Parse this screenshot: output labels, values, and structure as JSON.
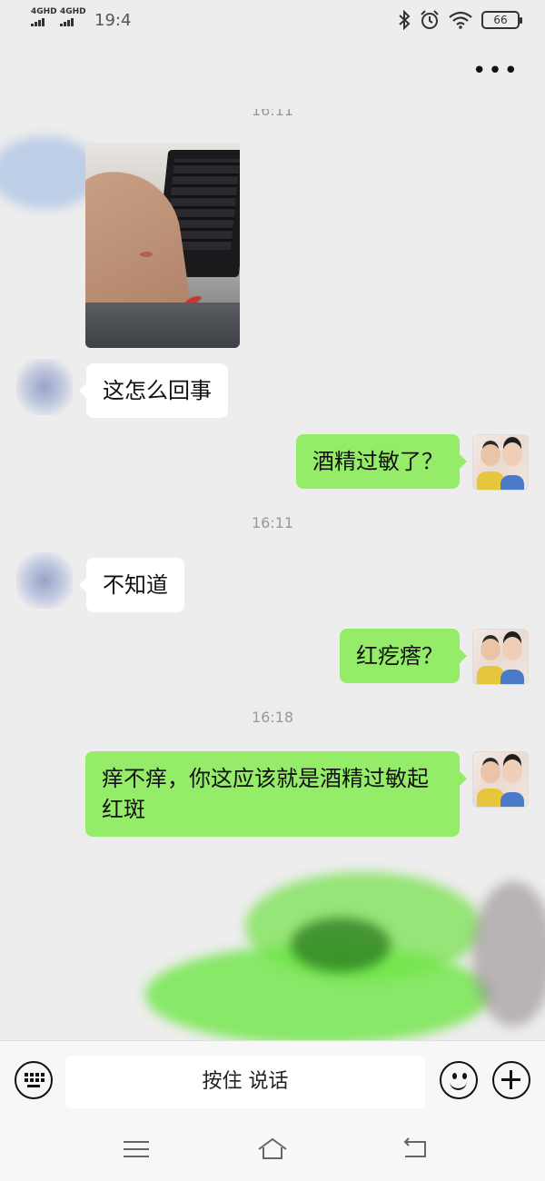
{
  "status_bar": {
    "network1": "4GHD",
    "network2": "4GHD",
    "time": "19:4",
    "battery": "66",
    "icons": [
      "bluetooth-icon",
      "alarm-icon",
      "wifi-icon",
      "battery-icon"
    ]
  },
  "header": {
    "more_label": "•••"
  },
  "messages": [
    {
      "type": "timestamp",
      "text": "16:11"
    },
    {
      "type": "image",
      "from": "contact"
    },
    {
      "type": "text",
      "from": "contact",
      "text": "这怎么回事"
    },
    {
      "type": "text",
      "from": "me",
      "text": "酒精过敏了？"
    },
    {
      "type": "timestamp",
      "text": "16:11"
    },
    {
      "type": "text",
      "from": "contact",
      "text": "不知道"
    },
    {
      "type": "text",
      "from": "me",
      "text": "红疙瘩？"
    },
    {
      "type": "timestamp",
      "text": "16:18"
    },
    {
      "type": "text",
      "from": "me",
      "text": "痒不痒，你这应该就是酒精过敏起红斑"
    }
  ],
  "input_bar": {
    "talk_label": "按住 说话",
    "icons": [
      "keyboard-icon",
      "emoji-icon",
      "plus-icon"
    ]
  },
  "nav_bar": {
    "icons": [
      "menu-icon",
      "home-icon",
      "back-icon"
    ]
  },
  "colors": {
    "background": "#ededed",
    "outgoing_bubble": "#95ec69",
    "incoming_bubble": "#ffffff",
    "timestamp": "#999999"
  }
}
